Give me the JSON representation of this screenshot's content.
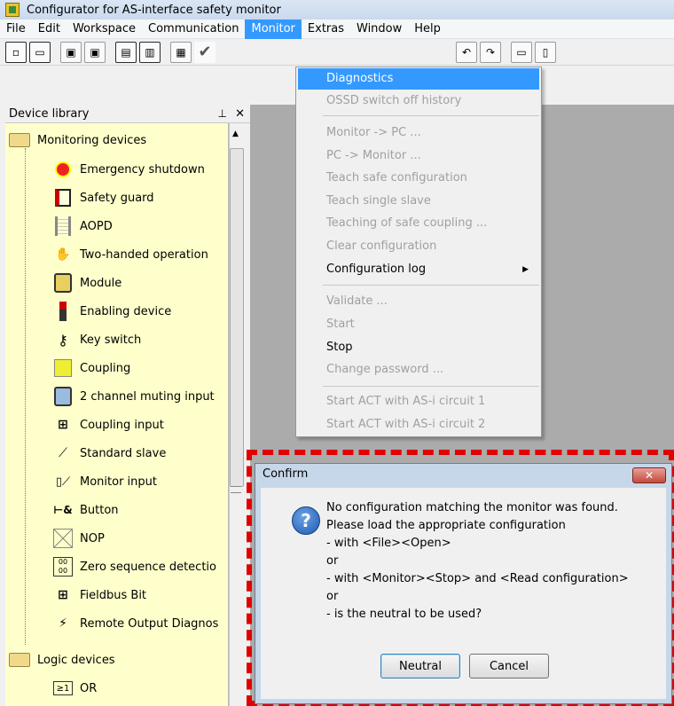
{
  "app": {
    "title": "Configurator for AS-interface safety monitor"
  },
  "menubar": [
    "File",
    "Edit",
    "Workspace",
    "Communication",
    "Monitor",
    "Extras",
    "Window",
    "Help"
  ],
  "library": {
    "title": "Device library",
    "pin_icon": "pin-icon",
    "close": "✕",
    "groups": [
      {
        "label": "Monitoring devices",
        "items": [
          "Emergency shutdown",
          "Safety guard",
          "AOPD",
          "Two-handed operation",
          "Module",
          "Enabling device",
          "Key switch",
          "Coupling",
          "2 channel muting input",
          "Coupling input",
          "Standard slave",
          "Monitor input",
          "Button",
          "NOP",
          "Zero sequence detectio",
          "Fieldbus Bit",
          "Remote Output Diagnos"
        ]
      },
      {
        "label": "Logic devices",
        "items": [
          "OR"
        ]
      }
    ]
  },
  "monitor_menu": {
    "items": [
      {
        "label": "Diagnostics",
        "state": "highlighted"
      },
      {
        "label": "OSSD switch off history",
        "state": "disabled"
      },
      {
        "label": "Monitor -> PC ...",
        "state": "disabled"
      },
      {
        "label": "PC -> Monitor ...",
        "state": "disabled"
      },
      {
        "label": "Teach safe configuration",
        "state": "disabled"
      },
      {
        "label": "Teach single slave",
        "state": "disabled"
      },
      {
        "label": "Teaching of safe coupling ...",
        "state": "disabled"
      },
      {
        "label": "Clear configuration",
        "state": "disabled"
      },
      {
        "label": "Configuration log",
        "state": "enabled",
        "submenu": true
      },
      {
        "label": "Validate ...",
        "state": "disabled"
      },
      {
        "label": "Start",
        "state": "disabled"
      },
      {
        "label": "Stop",
        "state": "enabled"
      },
      {
        "label": "Change password ...",
        "state": "disabled"
      },
      {
        "label": "Start ACT with AS-i circuit 1",
        "state": "disabled"
      },
      {
        "label": "Start ACT with AS-i circuit 2",
        "state": "disabled"
      }
    ]
  },
  "dialog": {
    "title": "Confirm",
    "lines": [
      "No configuration matching the monitor was found.",
      "Please load the appropriate configuration",
      "- with <File><Open>",
      "or",
      "- with <Monitor><Stop> and <Read configuration>",
      "or",
      "- is the neutral to be used?"
    ],
    "buttons": {
      "neutral": "Neutral",
      "cancel": "Cancel"
    },
    "icon": "question-icon"
  },
  "colors": {
    "highlight": "#3399ff",
    "library_bg": "#ffffcc",
    "dashed_outline": "#e00000"
  }
}
